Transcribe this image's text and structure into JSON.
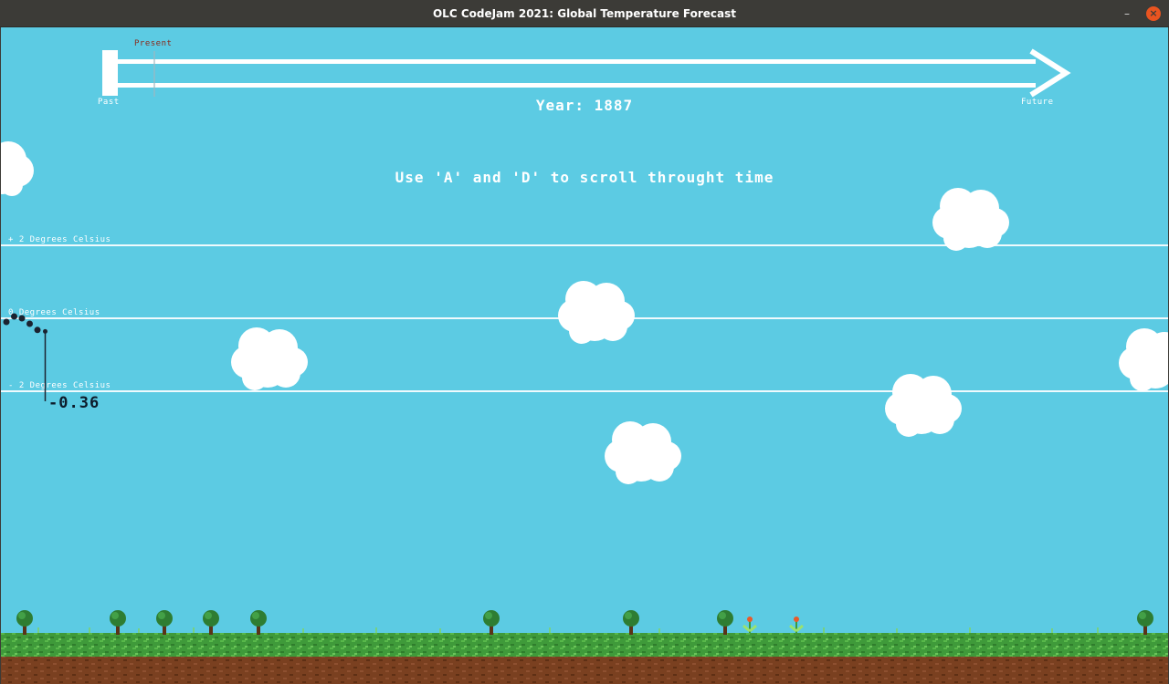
{
  "window": {
    "title": "OLC CodeJam 2021: Global Temperature Forecast",
    "minimize_glyph": "–",
    "close_glyph": "×"
  },
  "timeline": {
    "present_label": "Present",
    "past_label": "Past",
    "future_label": "Future",
    "year_text": "Year: 1887"
  },
  "instructions": "Use 'A' and 'D' to scroll throught time",
  "temperature_lines": {
    "plus2": "+ 2 Degrees Celsius",
    "zero": "0 Degrees Celsius",
    "minus2": "- 2 Degrees Celsius"
  },
  "current_value": "-0.36",
  "chart_data": {
    "type": "scatter",
    "ylim": [
      -2,
      2
    ],
    "points": [
      -0.1,
      0.05,
      0.0,
      -0.15,
      -0.32,
      -0.36
    ]
  },
  "colors": {
    "sky": "#5ccbe3",
    "cloud": "#ffffff",
    "grass": "#3f9a3a",
    "soil": "#7a4020",
    "point": "#1b2330"
  },
  "icons": {
    "tree": "tree-icon",
    "flower": "flower-icon",
    "cloud": "cloud-icon"
  }
}
